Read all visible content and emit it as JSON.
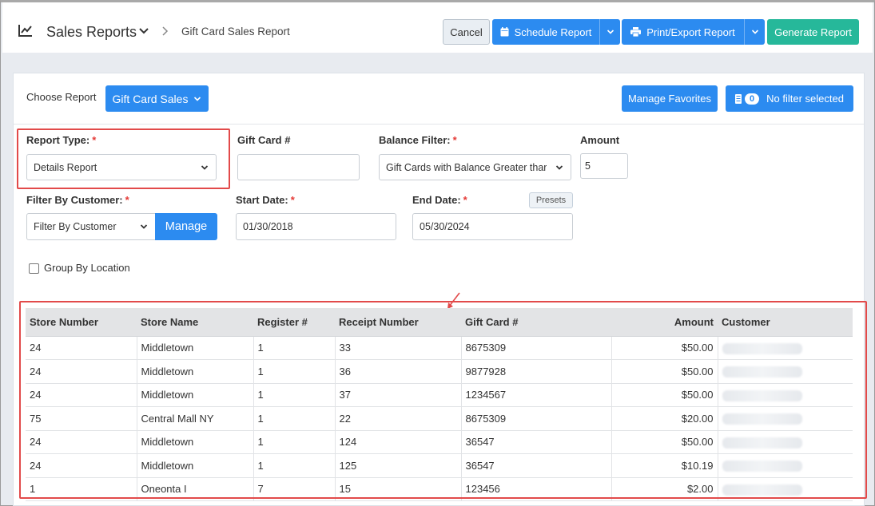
{
  "header": {
    "title": "Sales Reports",
    "breadcrumb": "Gift Card Sales Report",
    "buttons": {
      "cancel": "Cancel",
      "schedule": "Schedule Report",
      "print_export": "Print/Export Report",
      "generate": "Generate Report"
    }
  },
  "report_picker": {
    "label": "Choose Report",
    "selected": "Gift Card Sales",
    "manage_favorites": "Manage Favorites",
    "filter_count": "0",
    "filter_text": "No filter selected"
  },
  "form": {
    "report_type": {
      "label": "Report Type:",
      "required": "*",
      "value": "Details Report"
    },
    "gift_card": {
      "label": "Gift Card #",
      "value": ""
    },
    "balance_filter": {
      "label": "Balance Filter:",
      "required": "*",
      "value": "Gift Cards with Balance Greater thar"
    },
    "amount": {
      "label": "Amount",
      "value": "5"
    },
    "filter_customer": {
      "label": "Filter By Customer:",
      "required": "*",
      "value": "Filter By Customer",
      "manage": "Manage"
    },
    "start_date": {
      "label": "Start Date:",
      "required": "*",
      "value": "01/30/2018"
    },
    "end_date": {
      "label": "End Date:",
      "required": "*",
      "value": "05/30/2024",
      "presets": "Presets"
    },
    "group_by_location": {
      "label": "Group By Location",
      "checked": false
    }
  },
  "table": {
    "columns": [
      "Store Number",
      "Store Name",
      "Register #",
      "Receipt Number",
      "Gift Card #",
      "Amount",
      "Customer"
    ],
    "rows": [
      [
        "24",
        "Middletown",
        "1",
        "33",
        "8675309",
        "$50.00"
      ],
      [
        "24",
        "Middletown",
        "1",
        "36",
        "9877928",
        "$50.00"
      ],
      [
        "24",
        "Middletown",
        "1",
        "37",
        "1234567",
        "$50.00"
      ],
      [
        "75",
        "Central Mall NY",
        "1",
        "22",
        "8675309",
        "$20.00"
      ],
      [
        "24",
        "Middletown",
        "1",
        "124",
        "36547",
        "$50.00"
      ],
      [
        "24",
        "Middletown",
        "1",
        "125",
        "36547",
        "$10.19"
      ],
      [
        "1",
        "Oneonta I",
        "7",
        "15",
        "123456",
        "$2.00"
      ]
    ]
  },
  "colors": {
    "primary": "#2c8bf0",
    "success": "#26b89a",
    "highlight": "#e24a4a",
    "required": "#e53935"
  }
}
